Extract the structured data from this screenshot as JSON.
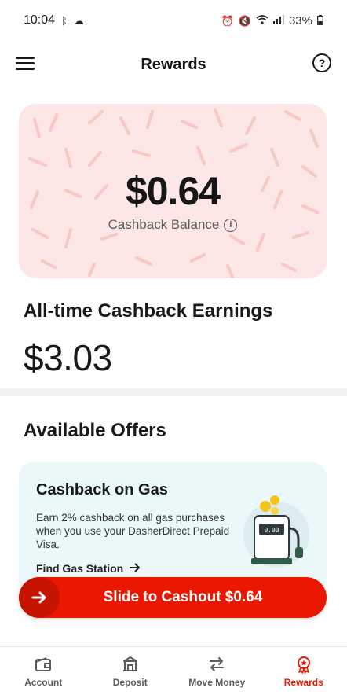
{
  "status_bar": {
    "time": "10:04",
    "battery": "33%"
  },
  "header": {
    "title": "Rewards"
  },
  "cashback_card": {
    "balance": "$0.64",
    "label": "Cashback Balance"
  },
  "all_time": {
    "label": "All-time Cashback Earnings",
    "value": "$3.03"
  },
  "offers": {
    "title": "Available Offers",
    "card": {
      "title": "Cashback on Gas",
      "description": "Earn 2% cashback on all gas purchases when you use your DasherDirect Prepaid Visa.",
      "link_label": "Find Gas Station",
      "pump_display": "0.00"
    }
  },
  "slide_cashout": {
    "label": "Slide to Cashout $0.64"
  },
  "bottom_nav": {
    "items": [
      {
        "label": "Account",
        "icon": "wallet-icon"
      },
      {
        "label": "Deposit",
        "icon": "bank-icon"
      },
      {
        "label": "Move Money",
        "icon": "transfer-arrows-icon"
      },
      {
        "label": "Rewards",
        "icon": "rewards-badge-icon",
        "active": true
      }
    ]
  },
  "colors": {
    "accent": "#eb1700",
    "card_pink": "#fde7e6",
    "card_teal": "#eaf8fa"
  }
}
